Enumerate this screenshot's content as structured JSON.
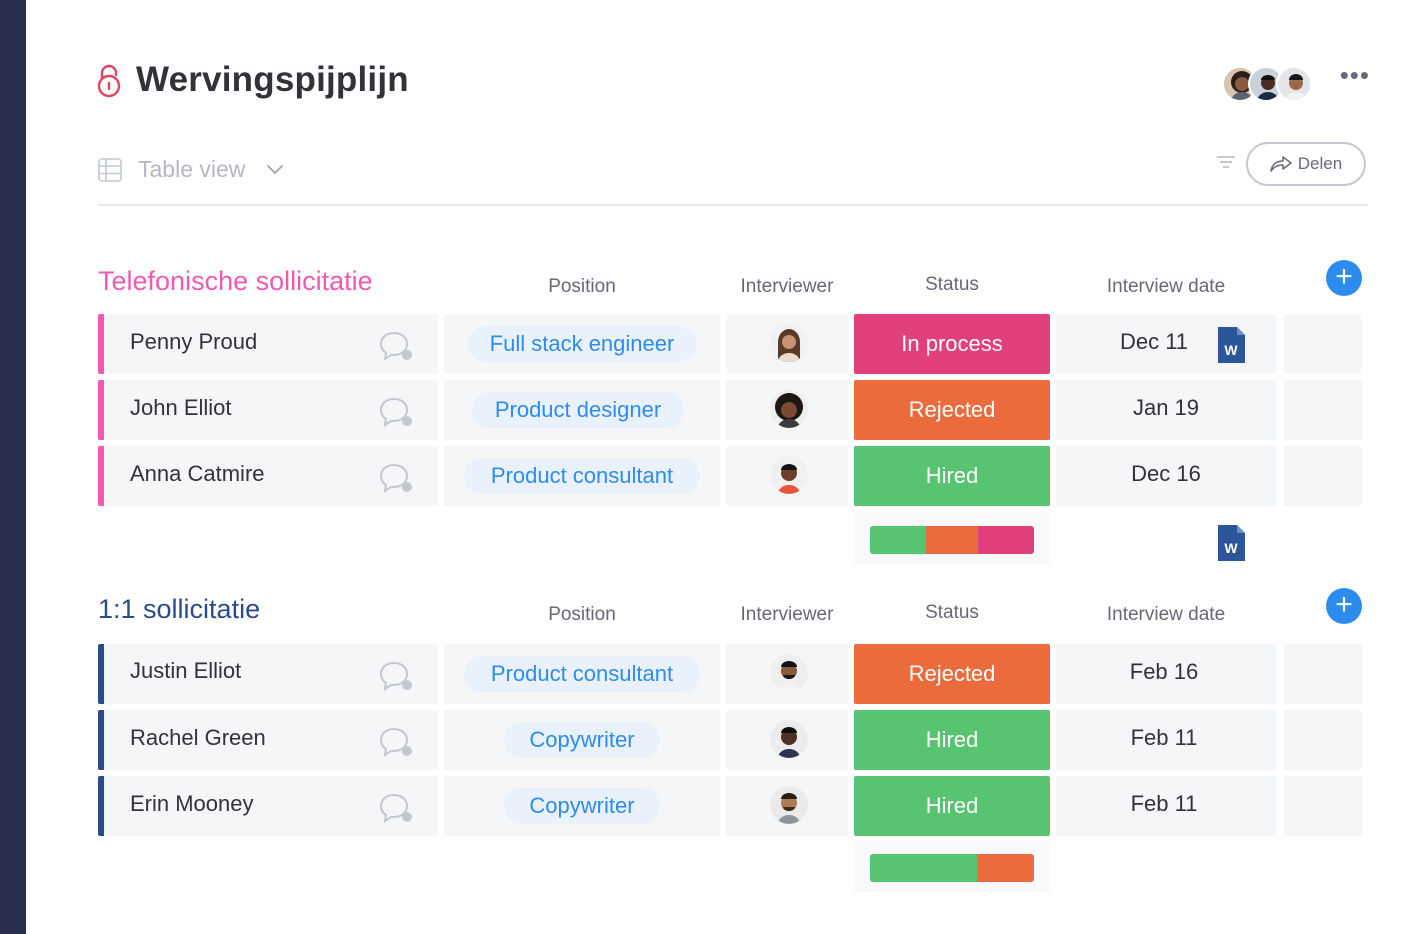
{
  "board": {
    "title": "Wervingspijplijn",
    "view_label": "Table view",
    "share_label": "Delen"
  },
  "colors": {
    "in_process": "#e2407b",
    "rejected": "#ec6b3d",
    "hired": "#58c472",
    "group1": "#f05ab3",
    "group2": "#2a4b8d",
    "accent": "#2d8cf0",
    "word_doc": "#2b579a"
  },
  "columns": {
    "position": "Position",
    "interviewer": "Interviewer",
    "status": "Status",
    "date": "Interview date"
  },
  "groups": [
    {
      "title": "Telefonische sollicitatie",
      "rows": [
        {
          "name": "Penny Proud",
          "position": "Full stack engineer",
          "status": "In process",
          "date": "Dec 11",
          "doc": true
        },
        {
          "name": "John Elliot",
          "position": "Product designer",
          "status": "Rejected",
          "date": "Jan 19",
          "doc": false
        },
        {
          "name": "Anna Catmire",
          "position": "Product consultant",
          "status": "Hired",
          "date": "Dec 16",
          "doc": false
        }
      ],
      "summary": [
        {
          "status": "Hired",
          "fraction": 0.34
        },
        {
          "status": "Rejected",
          "fraction": 0.32
        },
        {
          "status": "In process",
          "fraction": 0.34
        }
      ]
    },
    {
      "title": "1:1 sollicitatie",
      "rows": [
        {
          "name": "Justin Elliot",
          "position": "Product consultant",
          "status": "Rejected",
          "date": "Feb 16"
        },
        {
          "name": "Rachel Green",
          "position": "Copywriter",
          "status": "Hired",
          "date": "Feb 11"
        },
        {
          "name": "Erin Mooney",
          "position": "Copywriter",
          "status": "Hired",
          "date": "Feb 11"
        }
      ],
      "summary": [
        {
          "status": "Hired",
          "fraction": 0.65
        },
        {
          "status": "Rejected",
          "fraction": 0.35
        }
      ]
    }
  ],
  "icons": {
    "lock": "lock-icon",
    "table": "table-icon",
    "chevron": "chevron-down-icon",
    "filter": "filter-icon",
    "share": "share-arrow-icon",
    "more": "more-dots-icon",
    "add": "plus-icon",
    "chat": "chat-bubble-icon",
    "doc": "word-doc-icon"
  },
  "doc_letter": "W",
  "more_glyph": "•••",
  "add_glyph": "+"
}
